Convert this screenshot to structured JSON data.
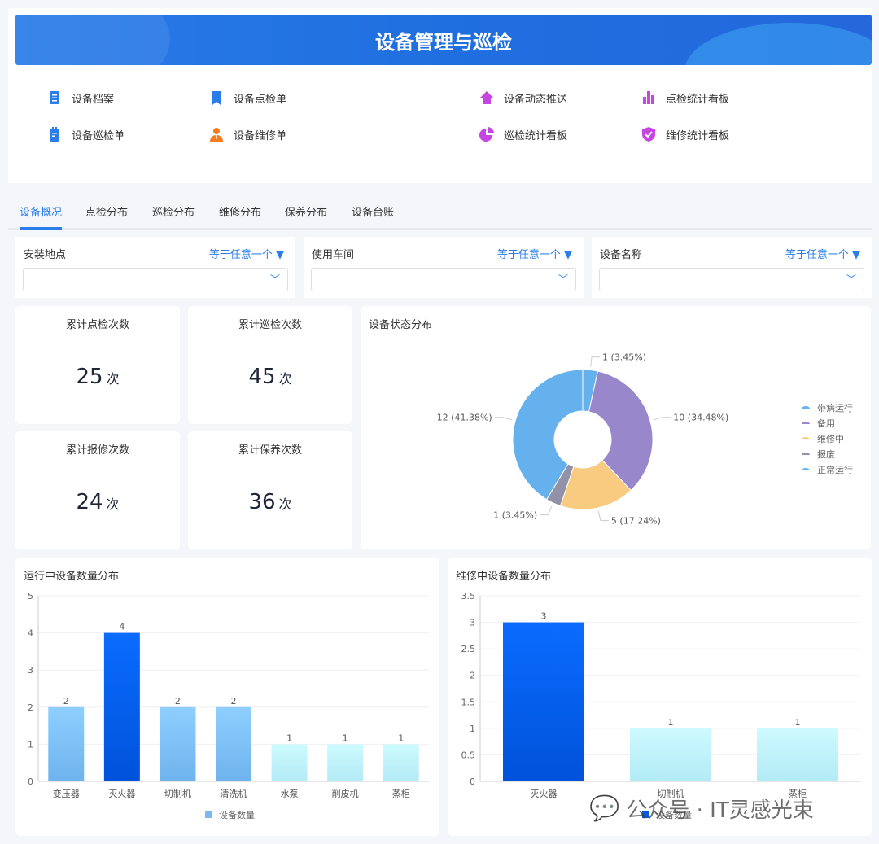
{
  "header": {
    "title": "设备管理与巡检"
  },
  "nav": [
    {
      "label": "设备档案",
      "icon": "document-icon",
      "color": "#2b7de9"
    },
    {
      "label": "设备点检单",
      "icon": "bookmark-icon",
      "color": "#2b7de9"
    },
    {
      "label": "设备动态推送",
      "icon": "home-icon",
      "color": "#c745e0"
    },
    {
      "label": "点检统计看板",
      "icon": "bar-chart-icon",
      "color": "#c745e0"
    },
    {
      "label": "设备巡检单",
      "icon": "clipboard-icon",
      "color": "#2b7de9"
    },
    {
      "label": "设备维修单",
      "icon": "worker-icon",
      "color": "#f47c1e"
    },
    {
      "label": "巡检统计看板",
      "icon": "pie-chart-icon",
      "color": "#c745e0"
    },
    {
      "label": "维修统计看板",
      "icon": "shield-check-icon",
      "color": "#c745e0"
    }
  ],
  "tabs": [
    "设备概况",
    "点检分布",
    "巡检分布",
    "维修分布",
    "保养分布",
    "设备台账"
  ],
  "filters": [
    {
      "label": "安装地点",
      "operator": "等于任意一个",
      "value": ""
    },
    {
      "label": "使用车间",
      "operator": "等于任意一个",
      "value": ""
    },
    {
      "label": "设备名称",
      "operator": "等于任意一个",
      "value": ""
    }
  ],
  "stats": [
    {
      "title": "累计点检次数",
      "value": "25",
      "unit": "次"
    },
    {
      "title": "累计巡检次数",
      "value": "45",
      "unit": "次"
    },
    {
      "title": "累计报修次数",
      "value": "24",
      "unit": "次"
    },
    {
      "title": "累计保养次数",
      "value": "36",
      "unit": "次"
    }
  ],
  "watermark": "公众号 · IT灵感光束",
  "chart_data": [
    {
      "type": "pie",
      "title": "设备状态分布",
      "donut": true,
      "legend": "right",
      "slices": [
        {
          "name": "带病运行",
          "value": 1,
          "label": "1 (3.45%)",
          "color": "#64b1ee"
        },
        {
          "name": "备用",
          "value": 10,
          "label": "10 (34.48%)",
          "color": "#9987cc"
        },
        {
          "name": "维修中",
          "value": 5,
          "label": "5 (17.24%)",
          "color": "#f9cb80"
        },
        {
          "name": "报废",
          "value": 1,
          "label": "1 (3.45%)",
          "color": "#9191a8"
        },
        {
          "name": "正常运行",
          "value": 12,
          "label": "12 (41.38%)",
          "color": "#64b1ee"
        }
      ]
    },
    {
      "type": "bar",
      "title": "运行中设备数量分布",
      "categories": [
        "变压器",
        "灭火器",
        "切制机",
        "清洗机",
        "水泵",
        "削皮机",
        "蒸柜"
      ],
      "series": [
        {
          "name": "设备数量",
          "values": [
            2,
            4,
            2,
            2,
            1,
            1,
            1
          ]
        }
      ],
      "ylim": [
        0,
        5
      ],
      "yticks": [
        0,
        1,
        2,
        3,
        4,
        5
      ],
      "legend": "bottom",
      "legend_color": "#7ab8f0",
      "grid": true
    },
    {
      "type": "bar",
      "title": "维修中设备数量分布",
      "categories": [
        "灭火器",
        "切制机",
        "蒸柜"
      ],
      "series": [
        {
          "name": "设备数量",
          "values": [
            3,
            1,
            1
          ]
        }
      ],
      "ylim": [
        0,
        3.5
      ],
      "yticks": [
        0,
        0.5,
        1,
        1.5,
        2,
        2.5,
        3,
        3.5
      ],
      "legend": "bottom",
      "legend_color": "#0a5ad8",
      "grid": true
    }
  ]
}
